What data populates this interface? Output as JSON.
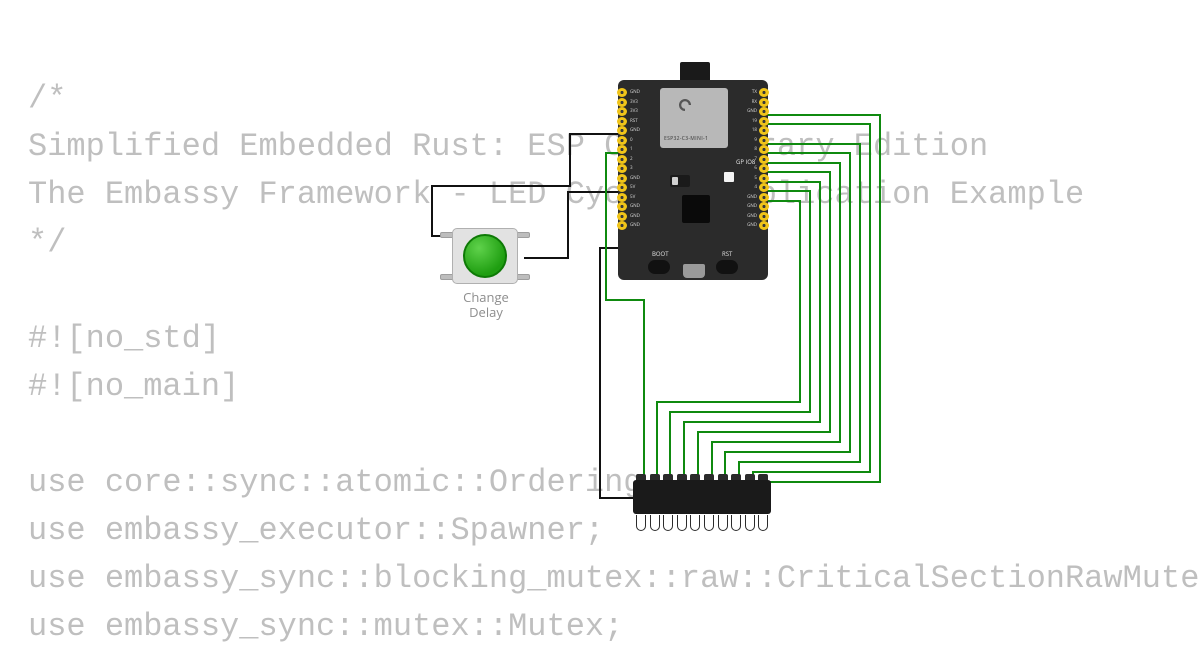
{
  "code": {
    "lines": [
      "/*",
      "Simplified Embedded Rust: ESP Core Library Edition",
      "The Embassy Framework - LED Cycling Application Example",
      "*/",
      "",
      "#![no_std]",
      "#![no_main]",
      "",
      "use core::sync::atomic::Ordering;",
      "use embassy_executor::Spawner;",
      "use embassy_sync::blocking_mutex::raw::CriticalSectionRawMutex;",
      "use embassy_sync::mutex::Mutex;"
    ]
  },
  "board": {
    "name": "ESP32-C3-MINI-1",
    "gp_label": "GP IO8",
    "buttons": {
      "boot": "BOOT",
      "rst": "RST"
    },
    "pins_left": [
      "GND",
      "3V3",
      "3V3",
      "RST",
      "GND",
      "0",
      "1",
      "2",
      "3",
      "GND",
      "5V",
      "5V",
      "GND",
      "GND",
      "GND"
    ],
    "pins_right": [
      "TX",
      "RX",
      "GND",
      "19",
      "18",
      "9",
      "8",
      "7",
      "6",
      "5",
      "4",
      "GND",
      "GND",
      "GND",
      "GND"
    ]
  },
  "push_button": {
    "label_line1": "Change",
    "label_line2": "Delay"
  },
  "led_bar": {
    "segments": 10
  },
  "wiring": {
    "description": "Green wires connect ESP32 right-side GPIO pins to LED bar segments; black wires connect push button to GND and a GPIO on the left header, and one black wire from left header to LED bar common.",
    "green_wire_count": 10,
    "black_wire_count": 3
  }
}
